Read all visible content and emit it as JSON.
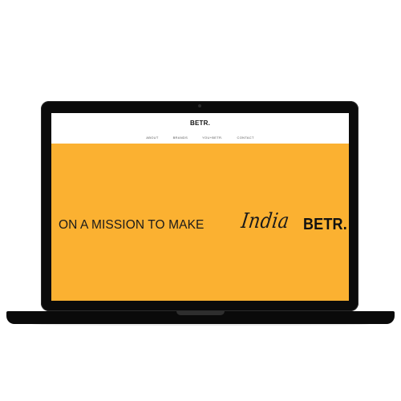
{
  "site": {
    "logo": "BETR.",
    "nav": [
      "ABOUT",
      "BRANDS",
      "YOU+BETR.",
      "CONTACT"
    ]
  },
  "hero": {
    "text": "ON A MISSION TO MAKE",
    "script": "India",
    "brand": "BETR.",
    "background_color": "#fbb131"
  },
  "colors": {
    "accent": "#fbb131",
    "device": "#0b0b0b"
  }
}
